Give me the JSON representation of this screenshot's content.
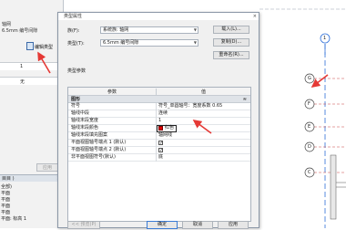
{
  "left_panel": {
    "line1": "轴网",
    "line2": "6.5mm 编号间隙",
    "edit_type_label": "编辑类型",
    "row_value": "1",
    "row2_value": "无",
    "apply_label": "应用"
  },
  "project_browser": {
    "title": "目目 )",
    "items": [
      "全部)",
      "平面",
      "平面",
      "平面",
      "平面",
      "平面: 标高 1"
    ],
    "close": "×"
  },
  "dialog": {
    "title": "类型属性",
    "close": "×",
    "family_label": "族(F):",
    "family_value": "系统族: 轴网",
    "type_label": "类型(T):",
    "type_value": "6.5mm 编号间隙",
    "buttons": {
      "load": "载入(L)...",
      "duplicate": "复制(D)...",
      "rename": "重命名(R)..."
    },
    "type_params_label": "类型参数",
    "grid_header": {
      "param": "参数",
      "value": "值"
    },
    "group": {
      "name": "图形",
      "toggle": "≈"
    },
    "rows": [
      {
        "name": "符号",
        "value": "符号_单圆轴号：宽度系数 0.65"
      },
      {
        "name": "轴线中段",
        "value": "连续"
      },
      {
        "name": "轴线末段宽度",
        "value": "1"
      },
      {
        "name": "轴线末段颜色",
        "value": "红色"
      },
      {
        "name": "轴线末段填充图案",
        "value": "轴网线"
      },
      {
        "name": "平面视图轴号端点 1 (默认)",
        "value": ""
      },
      {
        "name": "平面视图轴号端点 2 (默认)",
        "value": ""
      },
      {
        "name": "非平面视图符号(默认)",
        "value": "底"
      }
    ],
    "preview_label": "<< 预览(P)",
    "ok_label": "确定",
    "cancel_label": "取消",
    "apply_label": "应用"
  },
  "canvas": {
    "bubble_top": "1",
    "bubbles": [
      "G",
      "F",
      "E",
      "D",
      "C"
    ]
  },
  "colors": {
    "red_swatch": "#e00000",
    "grid_line": "#2e6fd8",
    "arrow": "#e53935"
  }
}
